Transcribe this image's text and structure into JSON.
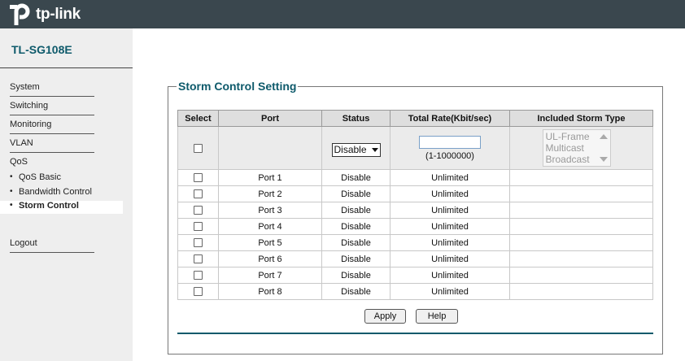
{
  "brand": {
    "logo_text": "tp-link",
    "model": "TL-SG108E",
    "accent": "#0e5a6b"
  },
  "menu": {
    "system": "System",
    "switching": "Switching",
    "monitoring": "Monitoring",
    "vlan": "VLAN",
    "qos": "QoS",
    "sub": [
      "QoS Basic",
      "Bandwidth Control",
      "Storm Control"
    ],
    "logout": "Logout"
  },
  "panel": {
    "title": "Storm Control Setting"
  },
  "table": {
    "headers": [
      "Select",
      "Port",
      "Status",
      "Total Rate(Kbit/sec)",
      "Included Storm Type"
    ],
    "edit": {
      "status_value": "Disable",
      "rate_value": "",
      "rate_hint": "(1-1000000)",
      "storm_types": [
        "UL-Frame",
        "Multicast",
        "Broadcast"
      ]
    },
    "rows": [
      {
        "port": "Port 1",
        "status": "Disable",
        "rate": "Unlimited",
        "types": ""
      },
      {
        "port": "Port 2",
        "status": "Disable",
        "rate": "Unlimited",
        "types": ""
      },
      {
        "port": "Port 3",
        "status": "Disable",
        "rate": "Unlimited",
        "types": ""
      },
      {
        "port": "Port 4",
        "status": "Disable",
        "rate": "Unlimited",
        "types": ""
      },
      {
        "port": "Port 5",
        "status": "Disable",
        "rate": "Unlimited",
        "types": ""
      },
      {
        "port": "Port 6",
        "status": "Disable",
        "rate": "Unlimited",
        "types": ""
      },
      {
        "port": "Port 7",
        "status": "Disable",
        "rate": "Unlimited",
        "types": ""
      },
      {
        "port": "Port 8",
        "status": "Disable",
        "rate": "Unlimited",
        "types": ""
      }
    ]
  },
  "buttons": {
    "apply": "Apply",
    "help": "Help"
  }
}
